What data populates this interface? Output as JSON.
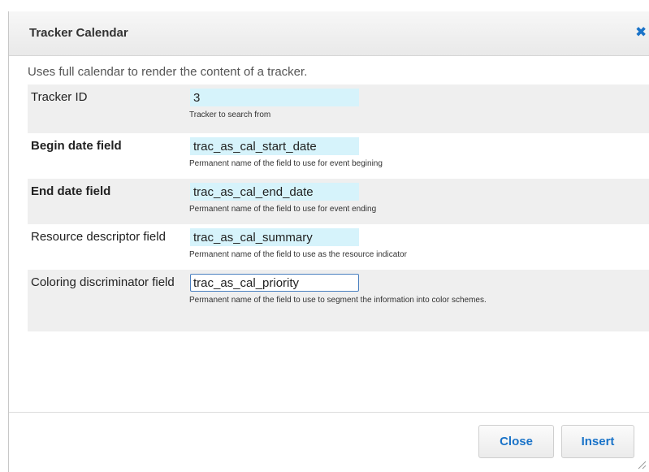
{
  "dialog": {
    "title": "Tracker Calendar",
    "close_glyph": "✖",
    "description": "Uses full calendar to render the content of a tracker."
  },
  "fields": [
    {
      "label": "Tracker ID",
      "value": "3",
      "help": "Tracker to search from",
      "bold": false
    },
    {
      "label": "Begin date field",
      "value": "trac_as_cal_start_date",
      "help": "Permanent name of the field to use for event begining",
      "bold": true
    },
    {
      "label": "End date field",
      "value": "trac_as_cal_end_date",
      "help": "Permanent name of the field to use for event ending",
      "bold": true
    },
    {
      "label": "Resource descriptor field",
      "value": "trac_as_cal_summary",
      "help": "Permanent name of the field to use as the resource indicator",
      "bold": false
    },
    {
      "label": "Coloring discriminator field",
      "value": "trac_as_cal_priority",
      "help": "Permanent name of the field to use to segment the information into color schemes.",
      "bold": false
    }
  ],
  "footer": {
    "close_label": "Close",
    "insert_label": "Insert"
  },
  "colors": {
    "accent": "#1a73c8",
    "input_bg": "#d6f3fb",
    "row_alt_bg": "#efefef"
  },
  "icons": {
    "close": "close-icon",
    "resize": "resize-grip-icon"
  }
}
